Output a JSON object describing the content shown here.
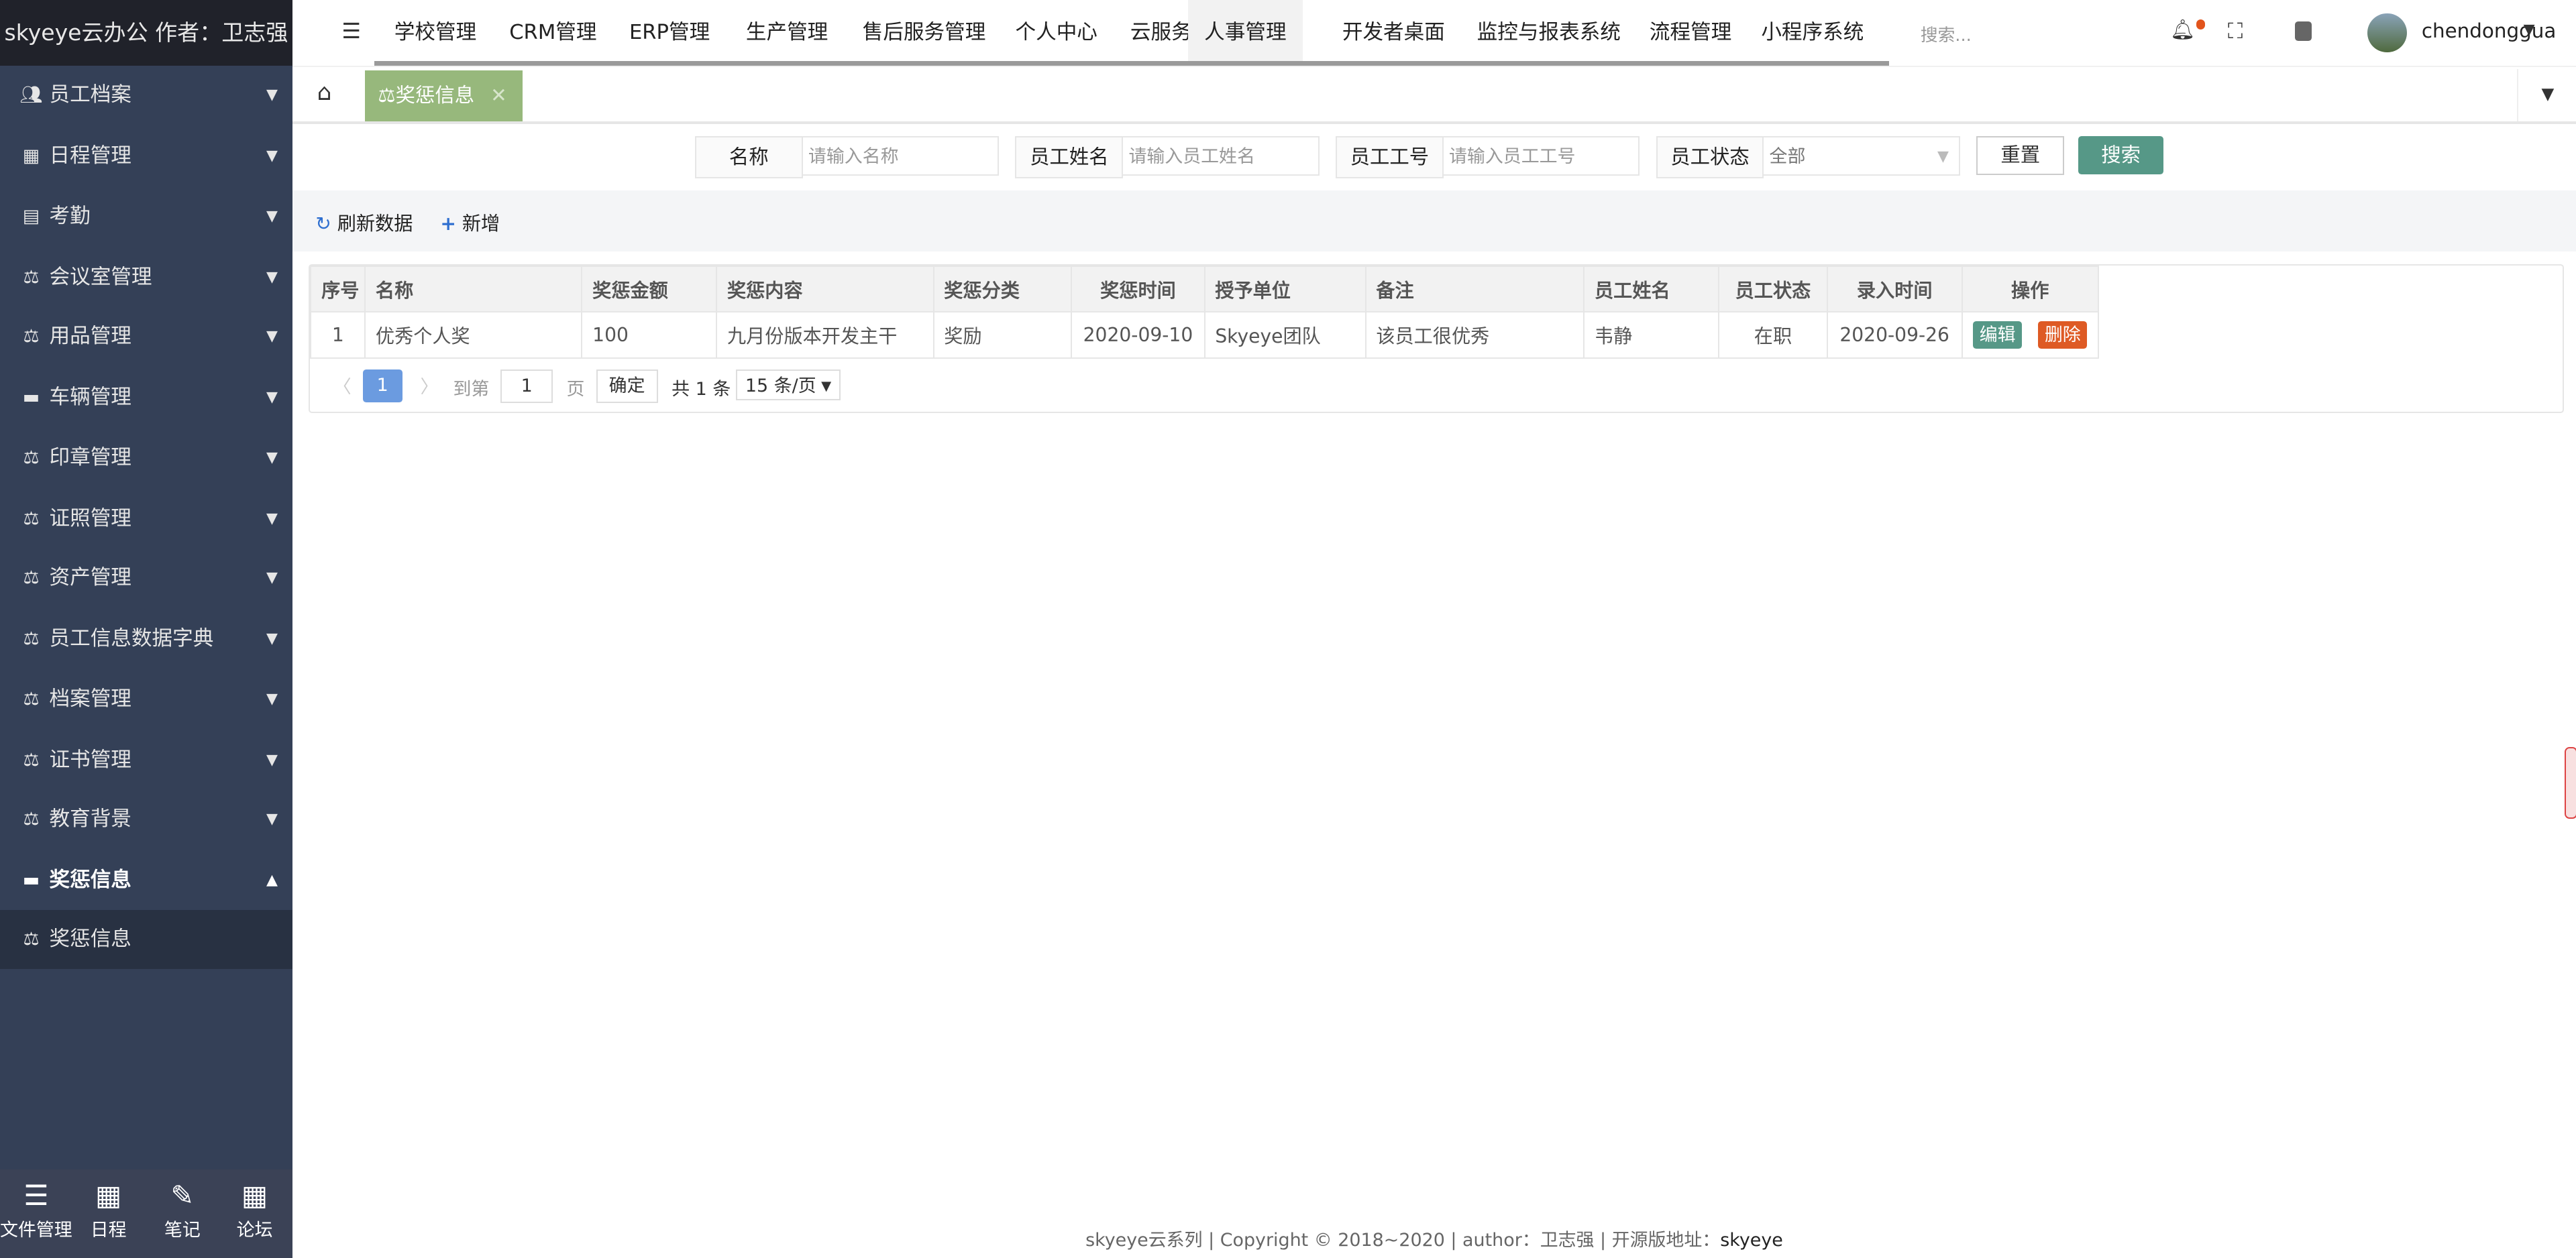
{
  "app": {
    "title": "skyeye云办公 作者：卫志强"
  },
  "sidebar": {
    "items": [
      {
        "icon": "users-icon",
        "label": "员工档案"
      },
      {
        "icon": "table-icon",
        "label": "日程管理"
      },
      {
        "icon": "id-card-icon",
        "label": "考勤"
      },
      {
        "icon": "balance-icon",
        "label": "会议室管理"
      },
      {
        "icon": "balance-icon",
        "label": "用品管理"
      },
      {
        "icon": "archive-icon",
        "label": "车辆管理"
      },
      {
        "icon": "balance-icon",
        "label": "印章管理"
      },
      {
        "icon": "balance-icon",
        "label": "证照管理"
      },
      {
        "icon": "balance-icon",
        "label": "资产管理"
      },
      {
        "icon": "balance-icon",
        "label": "员工信息数据字典"
      },
      {
        "icon": "balance-icon",
        "label": "档案管理"
      },
      {
        "icon": "balance-icon",
        "label": "证书管理"
      },
      {
        "icon": "balance-icon",
        "label": "教育背景"
      },
      {
        "icon": "archive-icon",
        "label": "奖惩信息",
        "open": true
      }
    ],
    "sub_items": [
      {
        "label": "奖惩信息"
      }
    ],
    "bottom": [
      {
        "label": "文件管理"
      },
      {
        "label": "日程"
      },
      {
        "label": "笔记"
      },
      {
        "label": "论坛"
      }
    ]
  },
  "topnav": {
    "items": [
      "学校管理",
      "CRM管理",
      "ERP管理",
      "生产管理",
      "售后服务管理",
      "个人中心",
      "云服务",
      "人事管理",
      "开发者桌面",
      "监控与报表系统",
      "流程管理",
      "小程序系统"
    ],
    "active": "人事管理",
    "search_placeholder": "搜索...",
    "username": "chendonggua"
  },
  "tabs": {
    "items": [
      {
        "label": "奖惩信息",
        "active": true
      }
    ]
  },
  "filters": {
    "name": {
      "label": "名称",
      "placeholder": "请输入名称"
    },
    "staff_name": {
      "label": "员工姓名",
      "placeholder": "请输入员工姓名"
    },
    "staff_no": {
      "label": "员工工号",
      "placeholder": "请输入员工工号"
    },
    "staff_state": {
      "label": "员工状态",
      "value": "全部"
    },
    "reset": "重置",
    "search": "搜索"
  },
  "toolbar": {
    "refresh": "刷新数据",
    "add": "新增"
  },
  "table": {
    "columns": [
      "序号",
      "名称",
      "奖惩金额",
      "奖惩内容",
      "奖惩分类",
      "奖惩时间",
      "授予单位",
      "备注",
      "员工姓名",
      "员工状态",
      "录入时间",
      "操作"
    ],
    "rows": [
      {
        "no": "1",
        "name": "优秀个人奖",
        "amount": "100",
        "content": "九月份版本开发主干",
        "type": "奖励",
        "time": "2020-09-10",
        "unit": "Skyeye团队",
        "remark": "该员工很优秀",
        "staff": "韦静",
        "state": "在职",
        "created": "2020-09-26",
        "edit": "编辑",
        "delete": "删除"
      }
    ]
  },
  "pager": {
    "current": "1",
    "goto_label": "到第",
    "goto_value": "1",
    "page_unit": "页",
    "confirm": "确定",
    "total": "共 1 条",
    "page_size": "15 条/页"
  },
  "footer": {
    "text": "skyeye云系列 | Copyright © 2018~2020 | author：卫志强 | 开源版地址：",
    "link": "skyeye"
  },
  "colors": {
    "sidebar": "#344057",
    "accent": "#569887",
    "danger": "#de5a24",
    "tab": "#97b87c",
    "page_active": "#6b9be0"
  }
}
